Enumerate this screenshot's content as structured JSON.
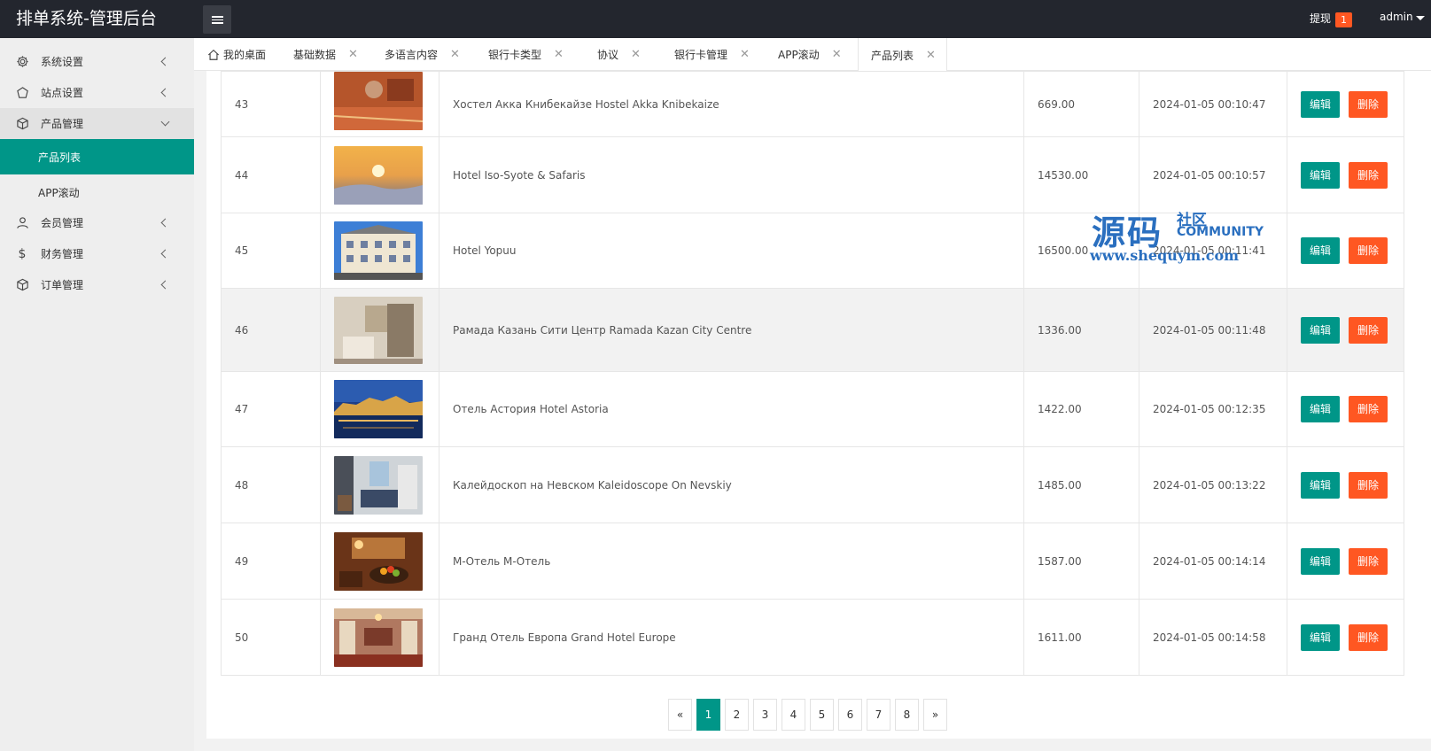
{
  "header": {
    "title": "排单系统-管理后台",
    "withdraw_label": "提现",
    "withdraw_count": "1",
    "user": "admin"
  },
  "sidebar": {
    "items": [
      {
        "label": "系统设置",
        "icon": "gear-icon"
      },
      {
        "label": "站点设置",
        "icon": "site-icon"
      },
      {
        "label": "产品管理",
        "icon": "box-icon"
      },
      {
        "label": "会员管理",
        "icon": "user-icon"
      },
      {
        "label": "财务管理",
        "icon": "dollar-icon"
      },
      {
        "label": "订单管理",
        "icon": "box-icon"
      }
    ],
    "sub_items": [
      {
        "label": "产品列表",
        "active": true
      },
      {
        "label": "APP滚动",
        "active": false
      }
    ]
  },
  "tabs": [
    {
      "label": "我的桌面"
    },
    {
      "label": "基础数据"
    },
    {
      "label": "多语言内容"
    },
    {
      "label": "银行卡类型"
    },
    {
      "label": "协议"
    },
    {
      "label": "银行卡管理"
    },
    {
      "label": "APP滚动"
    },
    {
      "label": "产品列表"
    }
  ],
  "table": {
    "rows": [
      {
        "id": "43",
        "name": "Хостел Акка Книбекайзе Hostel Akka Knibekaize",
        "price": "669.00",
        "time": "2024-01-05 00:10:47"
      },
      {
        "id": "44",
        "name": "Hotel Iso-Syote & Safaris",
        "price": "14530.00",
        "time": "2024-01-05 00:10:57"
      },
      {
        "id": "45",
        "name": "Hotel Yopuu",
        "price": "16500.00",
        "time": "2024-01-05 00:11:41"
      },
      {
        "id": "46",
        "name": "Рамада Казань Сити Центр Ramada Kazan City Centre",
        "price": "1336.00",
        "time": "2024-01-05 00:11:48"
      },
      {
        "id": "47",
        "name": "Отель Астория Hotel Astoria",
        "price": "1422.00",
        "time": "2024-01-05 00:12:35"
      },
      {
        "id": "48",
        "name": "Калейдоскоп на Невском Kaleidoscope On Nevskiy",
        "price": "1485.00",
        "time": "2024-01-05 00:13:22"
      },
      {
        "id": "49",
        "name": "М-Отель М-Отель",
        "price": "1587.00",
        "time": "2024-01-05 00:14:14"
      },
      {
        "id": "50",
        "name": "Гранд Отель Европа Grand Hotel Europe",
        "price": "1611.00",
        "time": "2024-01-05 00:14:58"
      }
    ],
    "edit_label": "编辑",
    "delete_label": "删除"
  },
  "pagination": {
    "prev": "«",
    "pages": [
      "1",
      "2",
      "3",
      "4",
      "5",
      "6",
      "7",
      "8"
    ],
    "next": "»",
    "current": "1"
  },
  "watermark": {
    "big": "源码",
    "small": "社区",
    "community": "COMMUNITY",
    "url": "www.shequym.com"
  },
  "colors": {
    "primary": "#009688",
    "danger": "#ff5722",
    "header_bg": "#23262e"
  }
}
